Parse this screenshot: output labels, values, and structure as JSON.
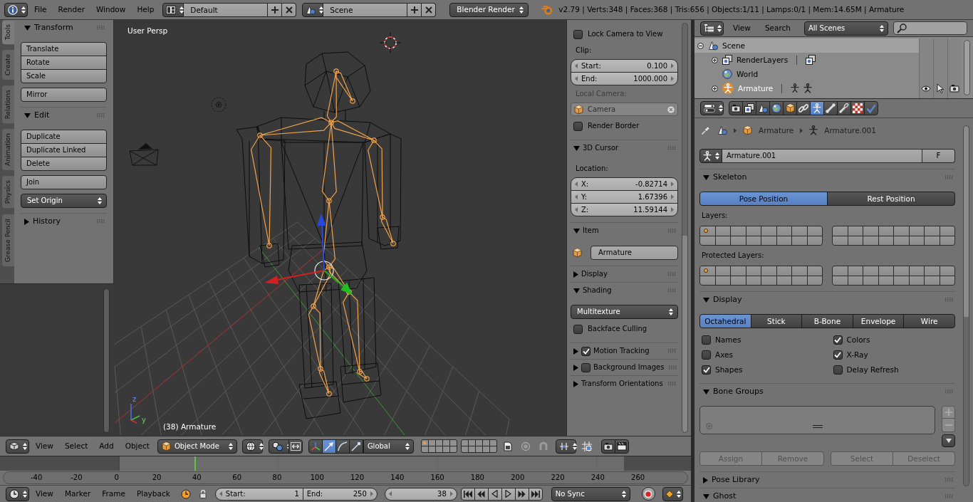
{
  "top_bar": {
    "menus": [
      "File",
      "Render",
      "Window",
      "Help"
    ],
    "layout": "Default",
    "scene": "Scene",
    "engine": "Blender Render",
    "stats": "v2.79 | Verts:348 | Faces:368 | Tris:656 | Objects:1/11 | Lamps:0/1 | Mem:14.65M | Armature"
  },
  "tool_shelf": {
    "tabs": [
      {
        "label": "Tools",
        "selected": true
      },
      {
        "label": "Create",
        "selected": false
      },
      {
        "label": "Relations",
        "selected": false
      },
      {
        "label": "Animation",
        "selected": false
      },
      {
        "label": "Physics",
        "selected": false
      },
      {
        "label": "Grease Pencil",
        "selected": false
      }
    ],
    "panels": [
      {
        "title": "Transform",
        "expanded": true,
        "items": [
          {
            "kind": "buttons",
            "labels": [
              "Translate",
              "Rotate",
              "Scale"
            ]
          },
          {
            "kind": "buttons",
            "labels": [
              "Mirror"
            ]
          }
        ]
      },
      {
        "title": "Edit",
        "expanded": true,
        "items": [
          {
            "kind": "buttons",
            "labels": [
              "Duplicate",
              "Duplicate Linked",
              "Delete"
            ]
          },
          {
            "kind": "buttons",
            "labels": [
              "Join"
            ]
          },
          {
            "kind": "menu",
            "label": "Set Origin"
          }
        ]
      },
      {
        "title": "History",
        "expanded": false
      }
    ]
  },
  "viewport": {
    "view_name": "User Persp",
    "object_info": "(38) Armature",
    "axis_labels": [
      "z",
      "y"
    ]
  },
  "sidebar": {
    "panels": [
      {
        "items": [
          {
            "kind": "checkbox",
            "label": "Lock Camera to View",
            "checked": false
          },
          {
            "kind": "label",
            "text": "Clip:",
            "disabled": false
          },
          {
            "kind": "numbers",
            "fields": [
              {
                "label": "Start:",
                "value": "0.100"
              },
              {
                "label": "End:",
                "value": "1000.000"
              }
            ]
          },
          {
            "kind": "label",
            "text": "Local Camera:",
            "disabled": true
          },
          {
            "kind": "object",
            "value": "Camera",
            "disabled": true
          },
          {
            "kind": "checkbox",
            "label": "Render Border",
            "checked": false
          }
        ]
      },
      {
        "title": "3D Cursor",
        "expanded": true,
        "items": [
          {
            "kind": "label",
            "text": "Location:",
            "disabled": false
          },
          {
            "kind": "numbers",
            "fields": [
              {
                "label": "X:",
                "value": "-0.82714"
              },
              {
                "label": "Y:",
                "value": "1.67396"
              },
              {
                "label": "Z:",
                "value": "11.59144"
              }
            ]
          }
        ]
      },
      {
        "title": "Item",
        "expanded": true,
        "items": [
          {
            "kind": "name",
            "value": "Armature"
          }
        ]
      },
      {
        "title": "Display",
        "expanded": false
      },
      {
        "title": "Shading",
        "expanded": true,
        "items": [
          {
            "kind": "menu",
            "label": "Multitexture"
          },
          {
            "kind": "checkbox",
            "label": "Backface Culling",
            "checked": false
          }
        ]
      },
      {
        "title": "Motion Tracking",
        "expanded": false,
        "toggle": {
          "checked": true
        }
      },
      {
        "title": "Background Images",
        "expanded": false,
        "toggle": {
          "checked": false
        }
      },
      {
        "title": "Transform Orientations",
        "expanded": false
      }
    ]
  },
  "outliner": {
    "menus": [
      "View",
      "Search"
    ],
    "filter": "All Scenes",
    "tree": [
      {
        "kind": "scene",
        "label": "Scene",
        "expanded": true,
        "selected": true,
        "active": false,
        "children": [
          {
            "kind": "layers",
            "label": "RenderLayers",
            "expanded": false,
            "selected": false,
            "active": false
          },
          {
            "kind": "world",
            "label": "World",
            "selected": false,
            "active": false
          },
          {
            "kind": "armature",
            "label": "Armature",
            "expanded": false,
            "selected": false,
            "active": true
          }
        ]
      }
    ]
  },
  "properties": {
    "tabs": [
      {
        "selected": false
      },
      {
        "selected": false
      },
      {
        "selected": false
      },
      {
        "selected": false
      },
      {
        "selected": false
      },
      {
        "selected": false
      },
      {
        "selected": true
      },
      {
        "selected": false
      },
      {
        "selected": false
      },
      {
        "selected": false
      },
      {
        "selected": false
      }
    ],
    "path": [
      {
        "kind": "scene"
      },
      {
        "kind": "object",
        "label": "Armature"
      },
      {
        "kind": "armature",
        "label": "Armature.001"
      }
    ],
    "datablock": {
      "name": "Armature.001",
      "fake_user": "F"
    },
    "panels": [
      {
        "title": "Skeleton",
        "expanded": true,
        "items": [
          {
            "kind": "toggles",
            "options": [
              {
                "label": "Pose Position",
                "selected": true
              },
              {
                "label": "Rest Position",
                "selected": false
              }
            ]
          },
          {
            "kind": "label",
            "text": "Layers:"
          },
          {
            "kind": "layers",
            "blocks": [
              {
                "cells": [
                  {
                    "used": true
                  },
                  {
                    "used": false
                  },
                  {
                    "used": false
                  },
                  {
                    "used": false
                  },
                  {
                    "used": false
                  },
                  {
                    "used": false
                  },
                  {
                    "used": false
                  },
                  {
                    "used": false
                  },
                  {
                    "used": false
                  },
                  {
                    "used": false
                  },
                  {
                    "used": false
                  },
                  {
                    "used": false
                  },
                  {
                    "used": false
                  },
                  {
                    "used": false
                  },
                  {
                    "used": false
                  },
                  {
                    "used": false
                  }
                ]
              },
              {
                "cells": [
                  {
                    "used": false
                  },
                  {
                    "used": false
                  },
                  {
                    "used": false
                  },
                  {
                    "used": false
                  },
                  {
                    "used": false
                  },
                  {
                    "used": false
                  },
                  {
                    "used": false
                  },
                  {
                    "used": false
                  },
                  {
                    "used": false
                  },
                  {
                    "used": false
                  },
                  {
                    "used": false
                  },
                  {
                    "used": false
                  },
                  {
                    "used": false
                  },
                  {
                    "used": false
                  },
                  {
                    "used": false
                  },
                  {
                    "used": false
                  }
                ]
              }
            ]
          },
          {
            "kind": "label",
            "text": "Protected Layers:"
          },
          {
            "kind": "layers",
            "blocks": [
              {
                "cells": [
                  {
                    "used": true
                  },
                  {
                    "used": false
                  },
                  {
                    "used": false
                  },
                  {
                    "used": false
                  },
                  {
                    "used": false
                  },
                  {
                    "used": false
                  },
                  {
                    "used": false
                  },
                  {
                    "used": false
                  },
                  {
                    "used": false
                  },
                  {
                    "used": false
                  },
                  {
                    "used": false
                  },
                  {
                    "used": false
                  },
                  {
                    "used": false
                  },
                  {
                    "used": false
                  },
                  {
                    "used": false
                  },
                  {
                    "used": false
                  }
                ]
              },
              {
                "cells": [
                  {
                    "used": false
                  },
                  {
                    "used": false
                  },
                  {
                    "used": false
                  },
                  {
                    "used": false
                  },
                  {
                    "used": false
                  },
                  {
                    "used": false
                  },
                  {
                    "used": false
                  },
                  {
                    "used": false
                  },
                  {
                    "used": false
                  },
                  {
                    "used": false
                  },
                  {
                    "used": false
                  },
                  {
                    "used": false
                  },
                  {
                    "used": false
                  },
                  {
                    "used": false
                  },
                  {
                    "used": false
                  },
                  {
                    "used": false
                  }
                ]
              }
            ]
          }
        ]
      },
      {
        "title": "Display",
        "expanded": true,
        "items": [
          {
            "kind": "toggles",
            "options": [
              {
                "label": "Octahedral",
                "selected": true
              },
              {
                "label": "Stick",
                "selected": false
              },
              {
                "label": "B-Bone",
                "selected": false
              },
              {
                "label": "Envelope",
                "selected": false
              },
              {
                "label": "Wire",
                "selected": false
              }
            ]
          },
          {
            "kind": "checks",
            "columns": [
              [
                {
                  "label": "Names",
                  "checked": false
                },
                {
                  "label": "Axes",
                  "checked": false
                },
                {
                  "label": "Shapes",
                  "checked": true
                }
              ],
              [
                {
                  "label": "Colors",
                  "checked": true
                },
                {
                  "label": "X-Ray",
                  "checked": true
                },
                {
                  "label": "Delay Refresh",
                  "checked": false
                }
              ]
            ]
          }
        ]
      },
      {
        "title": "Bone Groups",
        "expanded": true,
        "items": [
          {
            "kind": "list"
          },
          {
            "kind": "buttons",
            "disabled": true,
            "groups": [
              [
                "Assign",
                "Remove"
              ],
              [
                "Select",
                "Deselect"
              ]
            ]
          }
        ]
      },
      {
        "title": "Pose Library",
        "expanded": false
      },
      {
        "title": "Ghost",
        "expanded": true
      }
    ]
  },
  "view3d_header": {
    "menus": [
      "View",
      "Select",
      "Add",
      "Object"
    ],
    "mode": "Object Mode",
    "manipulators": [
      {
        "selected": false
      },
      {
        "selected": true
      },
      {
        "selected": false
      },
      {
        "selected": false
      }
    ],
    "orientation": "Global",
    "layers": [
      {
        "cells": [
          {
            "used": true
          },
          {
            "used": false
          },
          {
            "used": false
          },
          {
            "used": false
          },
          {
            "used": false
          },
          {
            "used": false
          },
          {
            "used": false
          },
          {
            "used": false
          },
          {
            "used": false
          },
          {
            "used": false
          }
        ]
      },
      {
        "cells": [
          {
            "used": false
          },
          {
            "used": false
          },
          {
            "used": false
          },
          {
            "used": false
          },
          {
            "used": false
          },
          {
            "used": false
          },
          {
            "used": false
          },
          {
            "used": false
          },
          {
            "used": false
          },
          {
            "used": false
          }
        ]
      }
    ]
  },
  "timeline": {
    "ruler": [
      "-40",
      "-20",
      "0",
      "20",
      "40",
      "60",
      "80",
      "100",
      "120",
      "140",
      "160",
      "180",
      "200",
      "220",
      "240",
      "260"
    ],
    "playhead": {
      "level": 0.282
    },
    "menus": [
      "View",
      "Marker",
      "Frame",
      "Playback"
    ],
    "start": {
      "label": "Start:",
      "value": "1"
    },
    "end": {
      "label": "End:",
      "value": "250"
    },
    "frame": "38",
    "sync": "No Sync"
  }
}
